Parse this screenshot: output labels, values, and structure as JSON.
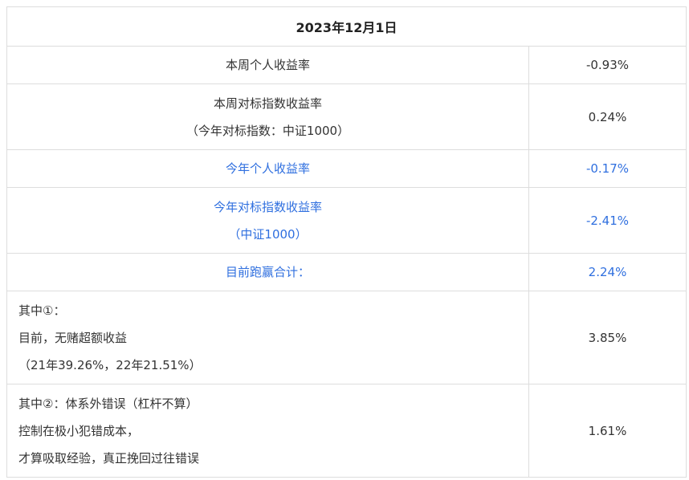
{
  "header": {
    "date": "2023年12月1日"
  },
  "rows": [
    {
      "label_lines": [
        "本周个人收益率"
      ],
      "value": "-0.93%"
    },
    {
      "label_lines": [
        "本周对标指数收益率",
        "（今年对标指数：中证1000）"
      ],
      "value": "0.24%"
    },
    {
      "label_lines": [
        "今年个人收益率"
      ],
      "value": "-0.17%"
    },
    {
      "label_lines": [
        "今年对标指数收益率",
        "（中证1000）"
      ],
      "value": "-2.41%"
    },
    {
      "label_lines": [
        "目前跑赢合计："
      ],
      "value": "2.24%"
    },
    {
      "label_lines": [
        "其中①：",
        "目前，无赌超额收益",
        "（21年39.26%，22年21.51%）"
      ],
      "value": "3.85%"
    },
    {
      "label_lines": [
        "其中②：体系外错误（杠杆不算）",
        "控制在极小犯错成本，",
        "才算吸取经验，真正挽回过往错误"
      ],
      "value": "1.61%"
    }
  ],
  "colors": {
    "text": "#333333",
    "highlight": "#2f6fdf",
    "border": "#dddddd"
  }
}
